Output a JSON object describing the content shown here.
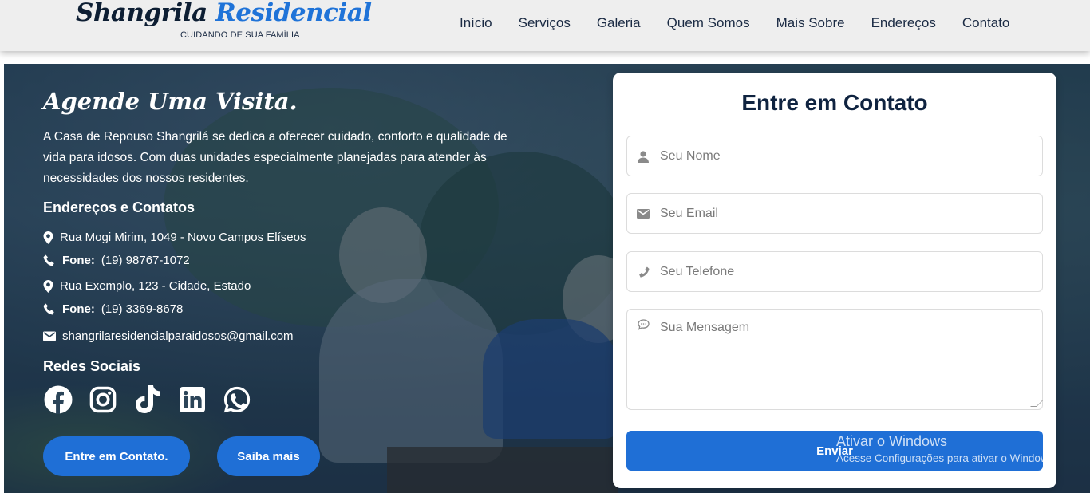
{
  "brand": {
    "name_part1": "Shangrila",
    "name_part2": "Residencial",
    "tagline": "CUIDANDO DE SUA FAMÍLIA"
  },
  "nav": {
    "items": [
      {
        "label": "Início"
      },
      {
        "label": "Serviços"
      },
      {
        "label": "Galeria"
      },
      {
        "label": "Quem Somos"
      },
      {
        "label": "Mais Sobre"
      },
      {
        "label": "Endereços"
      },
      {
        "label": "Contato"
      }
    ]
  },
  "hero": {
    "title": "Agende Uma Visita.",
    "description": "A Casa de Repouso Shangrilá se dedica a oferecer cuidado, conforto e qualidade de vida para idosos. Com duas unidades especialmente planejadas para atender às necessidades dos nossos residentes.",
    "contacts_heading": "Endereços e Contatos",
    "address1": "Rua Mogi Mirim, 1049 - Novo Campos Elíseos",
    "phone_label": "Fone:",
    "phone1": "(19) 98767-1072",
    "address2": "Rua Exemplo, 123 - Cidade, Estado",
    "phone2": "(19) 3369-8678",
    "email": "shangrilaresidencialparaidosos@gmail.com",
    "social_heading": "Redes Sociais",
    "socials": [
      "facebook-icon",
      "instagram-icon",
      "tiktok-icon",
      "linkedin-icon",
      "whatsapp-icon"
    ],
    "btn_contact": "Entre em Contato.",
    "btn_more": "Saiba mais"
  },
  "form": {
    "title": "Entre em Contato",
    "name_placeholder": "Seu Nome",
    "email_placeholder": "Seu Email",
    "phone_placeholder": "Seu Telefone",
    "message_placeholder": "Sua Mensagem",
    "submit_label": "Enviar"
  },
  "watermark": {
    "line1": "Ativar o Windows",
    "line2": "Acesse Configurações para ativar o Windows."
  },
  "colors": {
    "accent": "#1f6fd6",
    "brand_dark": "#0d1e33",
    "brand_blue": "#1f73d8"
  }
}
